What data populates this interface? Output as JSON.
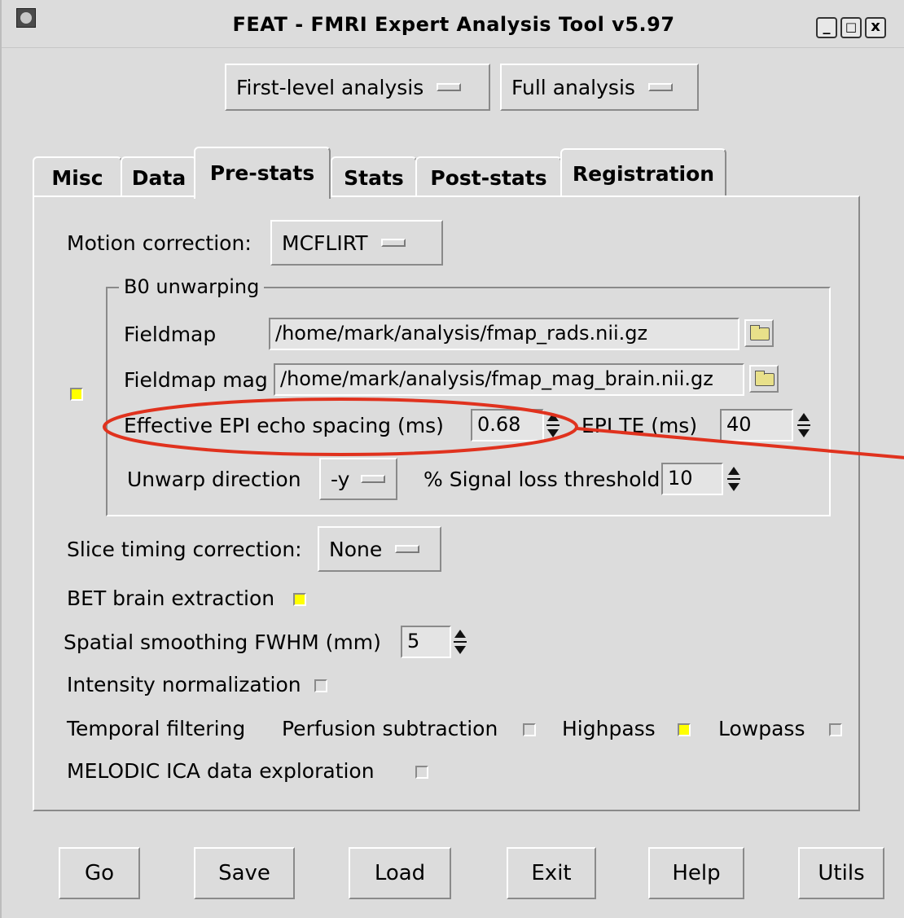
{
  "window": {
    "title": "FEAT - FMRI Expert Analysis Tool v5.97",
    "controls": [
      "_",
      "□",
      "x"
    ]
  },
  "top_menus": {
    "analysis_level": "First-level analysis",
    "analysis_type": "Full analysis"
  },
  "tabs": [
    {
      "label": "Misc"
    },
    {
      "label": "Data"
    },
    {
      "label": "Pre-stats",
      "active": true
    },
    {
      "label": "Stats"
    },
    {
      "label": "Post-stats"
    },
    {
      "label": "Registration"
    }
  ],
  "prestats": {
    "motion_correction_label": "Motion correction:",
    "motion_correction_value": "MCFLIRT",
    "b0": {
      "title": "B0 unwarping",
      "enabled": true,
      "fieldmap_label": "Fieldmap",
      "fieldmap_value": "/home/mark/analysis/fmap_rads.nii.gz",
      "fieldmap_mag_label": "Fieldmap mag",
      "fieldmap_mag_value": "/home/mark/analysis/fmap_mag_brain.nii.gz",
      "echo_spacing_label": "Effective EPI echo spacing (ms)",
      "echo_spacing_value": "0.68",
      "epi_te_label": "EPI TE (ms)",
      "epi_te_value": "40",
      "unwarp_direction_label": "Unwarp direction",
      "unwarp_direction_value": "-y",
      "signal_loss_label": "% Signal loss threshold",
      "signal_loss_value": "10"
    },
    "slice_timing_label": "Slice timing correction:",
    "slice_timing_value": "None",
    "bet_label": "BET brain extraction",
    "bet_checked": true,
    "smoothing_label": "Spatial smoothing FWHM (mm)",
    "smoothing_value": "5",
    "intensity_norm_label": "Intensity normalization",
    "intensity_norm_checked": false,
    "temporal_filtering_label": "Temporal filtering",
    "perfusion_label": "Perfusion subtraction",
    "perfusion_checked": false,
    "highpass_label": "Highpass",
    "highpass_checked": true,
    "lowpass_label": "Lowpass",
    "lowpass_checked": false,
    "melodic_label": "MELODIC ICA data exploration",
    "melodic_checked": false
  },
  "annotation": {
    "color": "#e0321e"
  },
  "buttons": {
    "go": "Go",
    "save": "Save",
    "load": "Load",
    "exit": "Exit",
    "help": "Help",
    "utils": "Utils"
  }
}
